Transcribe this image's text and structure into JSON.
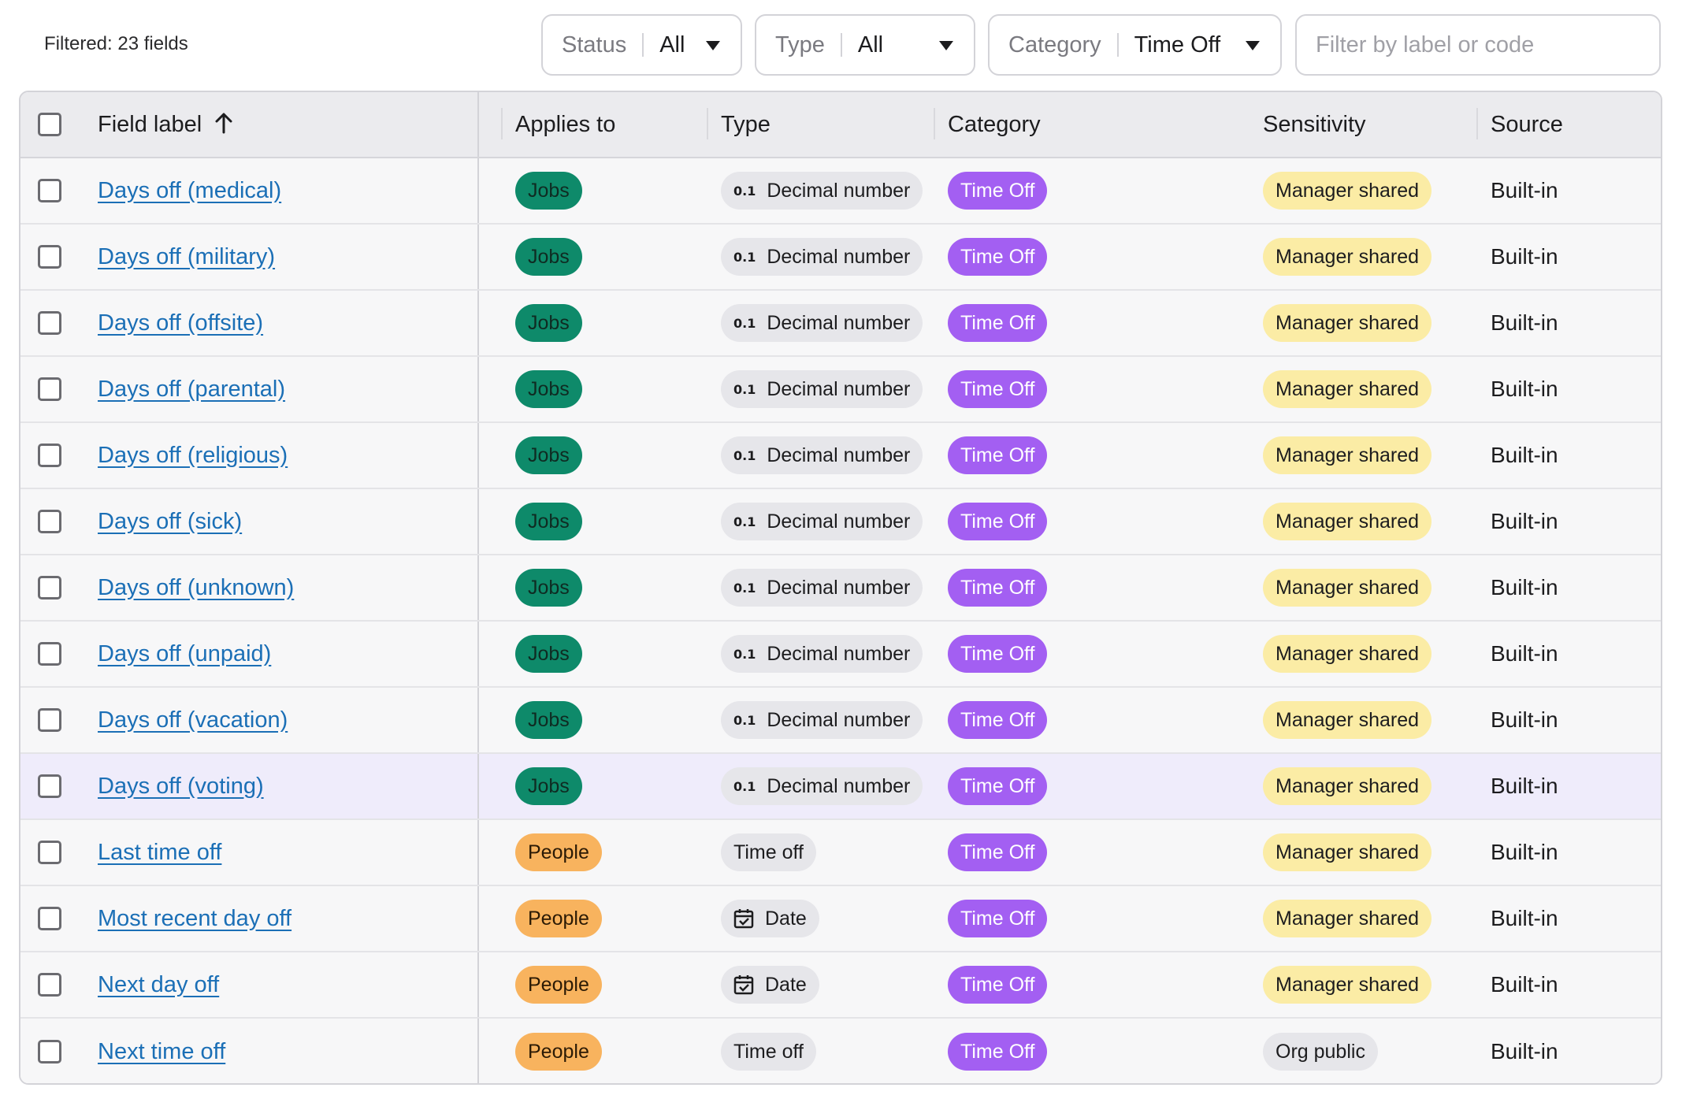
{
  "toolbar": {
    "filtered_count": "Filtered: 23 fields",
    "status": {
      "label": "Status",
      "value": "All"
    },
    "type": {
      "label": "Type",
      "value": "All"
    },
    "category": {
      "label": "Category",
      "value": "Time Off"
    },
    "search_placeholder": "Filter by label or code"
  },
  "columns": {
    "field_label": "Field label",
    "applies_to": "Applies to",
    "type": "Type",
    "category": "Category",
    "sensitivity": "Sensitivity",
    "source": "Source"
  },
  "sort": {
    "column": "Field label",
    "direction": "ascending",
    "icon": "arrow-up-icon"
  },
  "colors": {
    "jobs": "#0e8a6a",
    "people": "#f8b35e",
    "time_off": "#a35ff2",
    "manager_shared": "#fbeca5",
    "link": "#1b6fb6",
    "highlight_row": "#efecfb"
  },
  "rows": [
    {
      "label": "Days off (medical)",
      "applies_to": "Jobs",
      "type": "Decimal number",
      "type_icon": "0.1",
      "category": "Time Off",
      "sensitivity": "Manager shared",
      "source": "Built-in"
    },
    {
      "label": "Days off (military)",
      "applies_to": "Jobs",
      "type": "Decimal number",
      "type_icon": "0.1",
      "category": "Time Off",
      "sensitivity": "Manager shared",
      "source": "Built-in"
    },
    {
      "label": "Days off (offsite)",
      "applies_to": "Jobs",
      "type": "Decimal number",
      "type_icon": "0.1",
      "category": "Time Off",
      "sensitivity": "Manager shared",
      "source": "Built-in"
    },
    {
      "label": "Days off (parental)",
      "applies_to": "Jobs",
      "type": "Decimal number",
      "type_icon": "0.1",
      "category": "Time Off",
      "sensitivity": "Manager shared",
      "source": "Built-in"
    },
    {
      "label": "Days off (religious)",
      "applies_to": "Jobs",
      "type": "Decimal number",
      "type_icon": "0.1",
      "category": "Time Off",
      "sensitivity": "Manager shared",
      "source": "Built-in"
    },
    {
      "label": "Days off (sick)",
      "applies_to": "Jobs",
      "type": "Decimal number",
      "type_icon": "0.1",
      "category": "Time Off",
      "sensitivity": "Manager shared",
      "source": "Built-in"
    },
    {
      "label": "Days off (unknown)",
      "applies_to": "Jobs",
      "type": "Decimal number",
      "type_icon": "0.1",
      "category": "Time Off",
      "sensitivity": "Manager shared",
      "source": "Built-in"
    },
    {
      "label": "Days off (unpaid)",
      "applies_to": "Jobs",
      "type": "Decimal number",
      "type_icon": "0.1",
      "category": "Time Off",
      "sensitivity": "Manager shared",
      "source": "Built-in"
    },
    {
      "label": "Days off (vacation)",
      "applies_to": "Jobs",
      "type": "Decimal number",
      "type_icon": "0.1",
      "category": "Time Off",
      "sensitivity": "Manager shared",
      "source": "Built-in"
    },
    {
      "label": "Days off (voting)",
      "applies_to": "Jobs",
      "type": "Decimal number",
      "type_icon": "0.1",
      "category": "Time Off",
      "sensitivity": "Manager shared",
      "source": "Built-in",
      "highlighted": true
    },
    {
      "label": "Last time off",
      "applies_to": "People",
      "type": "Time off",
      "type_icon": "",
      "category": "Time Off",
      "sensitivity": "Manager shared",
      "source": "Built-in"
    },
    {
      "label": "Most recent day off",
      "applies_to": "People",
      "type": "Date",
      "type_icon": "calendar-icon",
      "category": "Time Off",
      "sensitivity": "Manager shared",
      "source": "Built-in"
    },
    {
      "label": "Next day off",
      "applies_to": "People",
      "type": "Date",
      "type_icon": "calendar-icon",
      "category": "Time Off",
      "sensitivity": "Manager shared",
      "source": "Built-in"
    },
    {
      "label": "Next time off",
      "applies_to": "People",
      "type": "Time off",
      "type_icon": "",
      "category": "Time Off",
      "sensitivity": "Org public",
      "source": "Built-in"
    }
  ]
}
